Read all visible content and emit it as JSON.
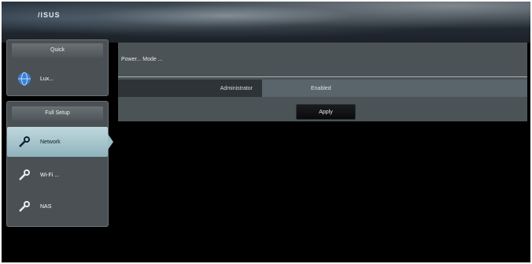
{
  "brand": {
    "logo_text": "/ISUS"
  },
  "nav": {
    "section_quick": {
      "label": "Quick"
    },
    "quick_item": {
      "label": "Lux..."
    },
    "section_settings": {
      "label": "Full Setup"
    },
    "items": [
      {
        "label": "Network",
        "icon": "wrench-icon",
        "selected": true
      },
      {
        "label": "Wi-Fi ...",
        "icon": "wrench-icon",
        "selected": false
      },
      {
        "label": "NAS",
        "icon": "wrench-icon",
        "selected": false
      }
    ]
  },
  "content": {
    "header_text": "Power... Mode ...",
    "field_label": "Administrator",
    "field_value": "Enabled",
    "apply_label": "Apply"
  }
}
